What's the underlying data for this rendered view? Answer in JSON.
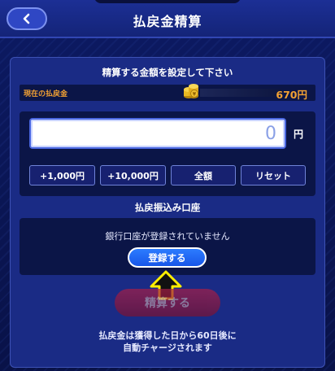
{
  "header": {
    "title": "払戻金精算",
    "back_icon": "chevron-left-icon"
  },
  "panel": {
    "instruction": "精算する金額を設定して下さい",
    "balance": {
      "label": "現在の払戻金",
      "value": "670円",
      "icon": "coin-stack-icon"
    },
    "amount": {
      "value": "0",
      "suffix": "円"
    },
    "quick_buttons": [
      "+1,000円",
      "+10,000円",
      "全額",
      "リセット"
    ],
    "bank": {
      "section_title": "払戻振込み口座",
      "message": "銀行口座が登録されていません",
      "register_label": "登録する"
    },
    "settle_label": "精算する",
    "note_line1": "払戻金は獲得した日から60日後に",
    "note_line2": "自動チャージされます"
  },
  "colors": {
    "accent_orange": "#f2a133",
    "register_blue": "#1f66f2",
    "settle_red": "#a81f48",
    "hint_arrow_yellow": "#ffee00"
  }
}
